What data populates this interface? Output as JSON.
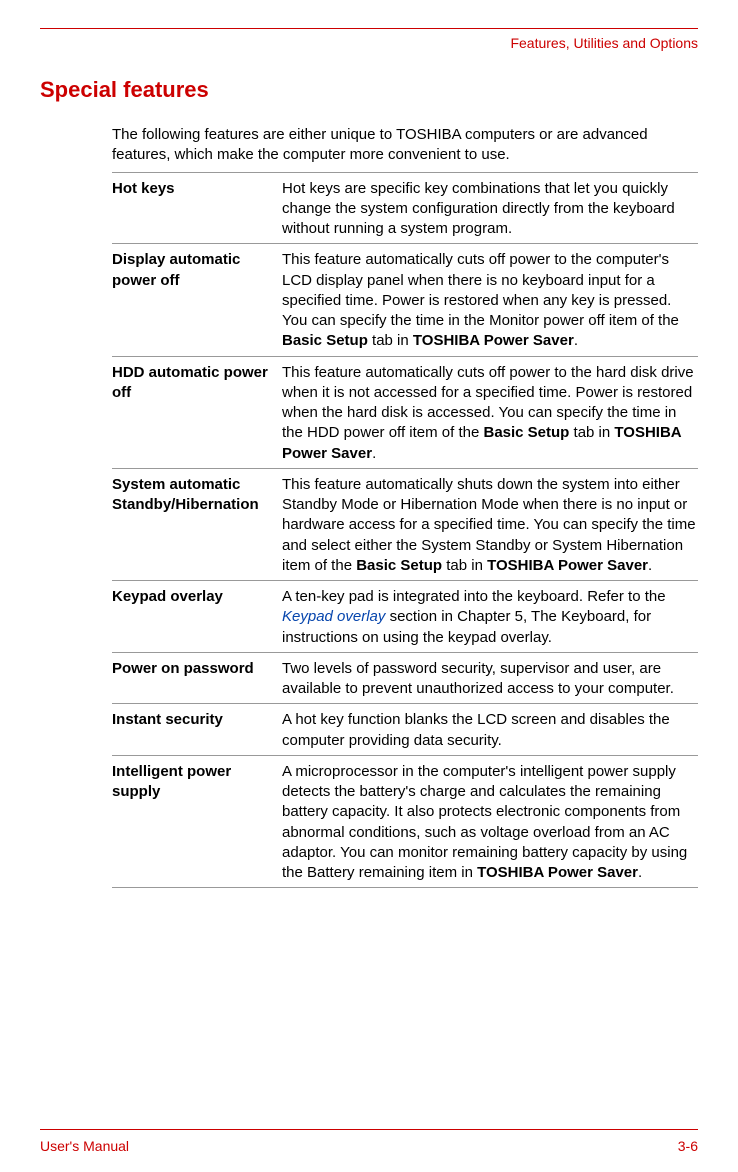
{
  "header": {
    "breadcrumb": "Features, Utilities and Options"
  },
  "section_title": "Special features",
  "intro": "The following features are either unique to TOSHIBA computers or are advanced features, which make the computer more convenient to use.",
  "features": [
    {
      "name": "Hot keys",
      "desc_plain": "Hot keys are specific key combinations that let you quickly change the system configuration directly from the keyboard without running a system program."
    },
    {
      "name": "Display automatic power off",
      "desc_pre": "This feature automatically cuts off power to the computer's LCD display panel when there is no keyboard input for a specified time. Power is restored when any key is pressed. You can specify the time in the Monitor power off item of the ",
      "bold1": "Basic Setup",
      "mid1": " tab in ",
      "bold2": "TOSHIBA Power Saver",
      "post": "."
    },
    {
      "name": "HDD automatic power off",
      "desc_pre": "This feature automatically cuts off power to the hard disk drive when it is not accessed for a specified time. Power is restored when the hard disk is accessed. You can specify the time in the HDD power off item of the ",
      "bold1": "Basic Setup",
      "mid1": " tab in ",
      "bold2": "TOSHIBA Power Saver",
      "post": "."
    },
    {
      "name": "System automatic Standby/Hibernation",
      "desc_pre": "This feature automatically shuts down the system into either Standby Mode or Hibernation Mode when there is no input or hardware access for a specified time. You can specify the time and select either the System Standby or System Hibernation item of the ",
      "bold1": "Basic Setup",
      "mid1": " tab in ",
      "bold2": "TOSHIBA Power Saver",
      "post": "."
    },
    {
      "name": "Keypad overlay",
      "ko_pre": "A ten-key pad is integrated into the keyboard. Refer to the ",
      "ko_link": "Keypad overlay",
      "ko_post": " section in Chapter 5, The Keyboard, for instructions on using the keypad overlay."
    },
    {
      "name": "Power on password",
      "desc_plain": "Two levels of password security, supervisor and user, are available to prevent unauthorized access to your computer."
    },
    {
      "name": "Instant security",
      "desc_plain": "A hot key function blanks the LCD screen and disables the computer providing data security."
    },
    {
      "name": "Intelligent power supply",
      "ips_pre": "A microprocessor in the computer's intelligent power supply detects the battery's charge and calculates the remaining battery capacity. It also protects electronic components from abnormal conditions, such as voltage overload from an AC adaptor. You can monitor remaining battery capacity by using the Battery remaining item in ",
      "ips_bold": "TOSHIBA Power Saver",
      "ips_post": "."
    }
  ],
  "footer": {
    "left": "User's Manual",
    "right": "3-6"
  }
}
